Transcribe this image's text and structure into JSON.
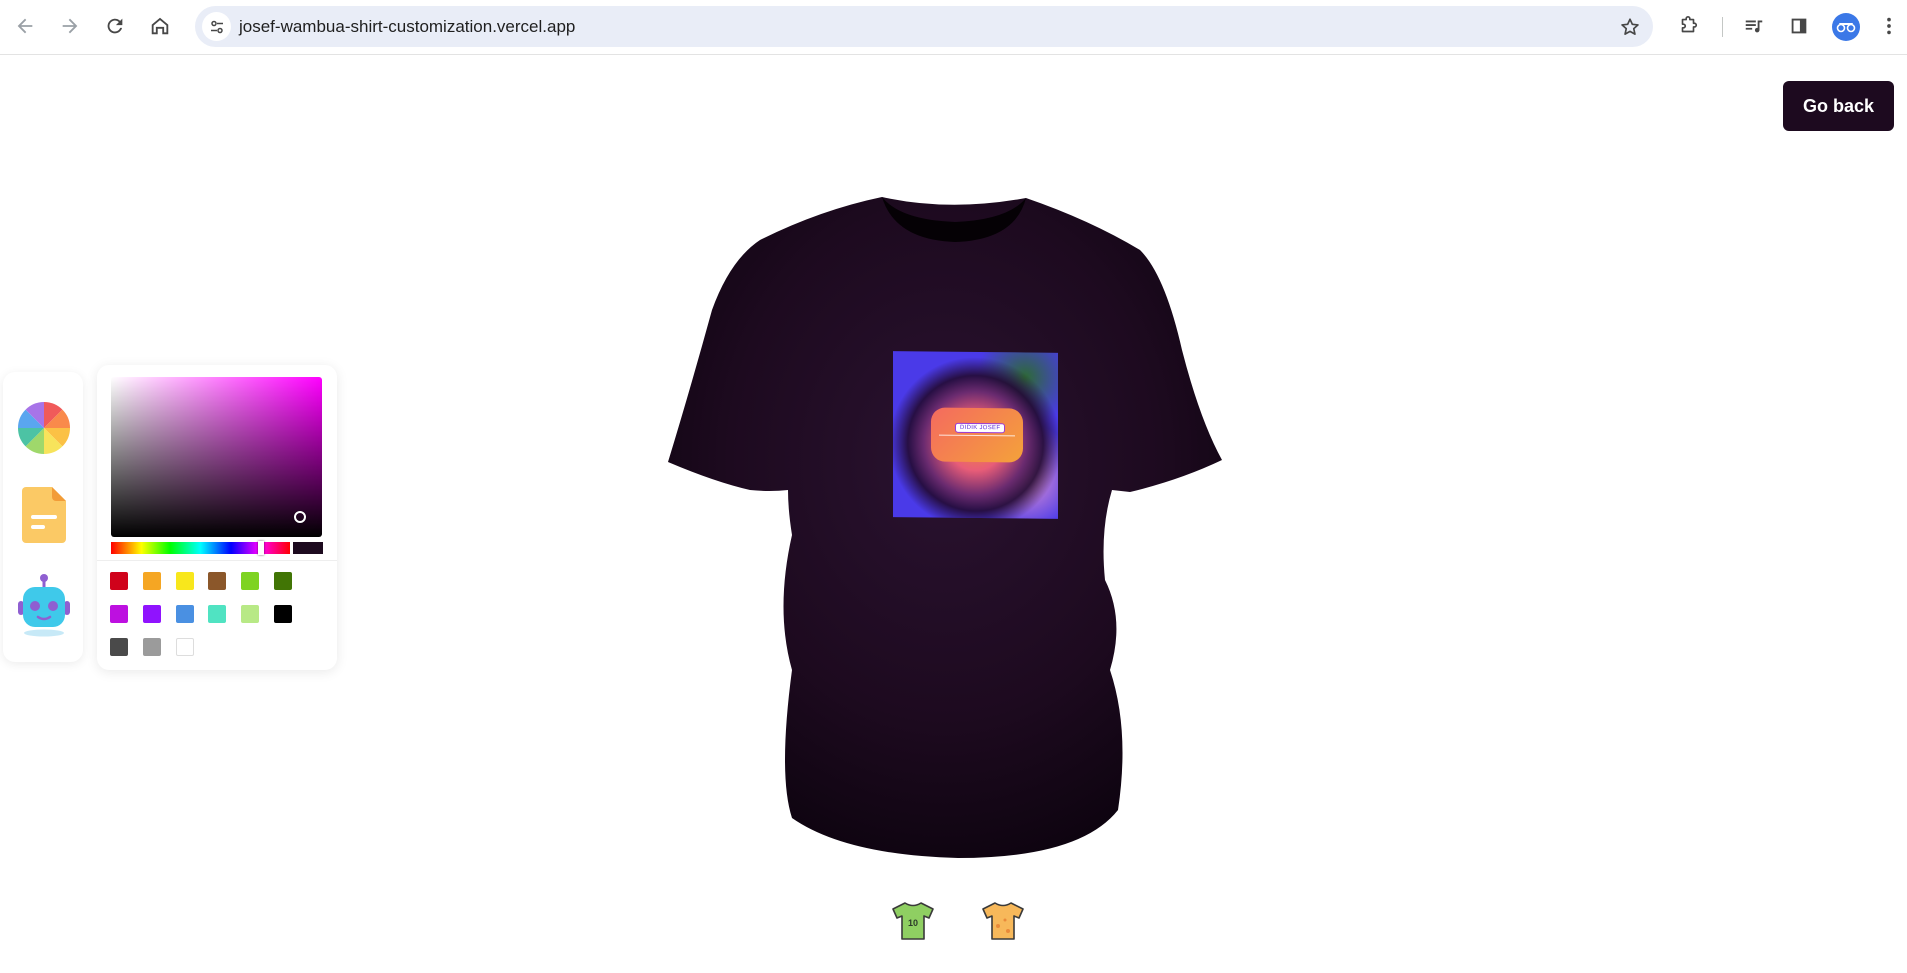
{
  "browser": {
    "url": "josef-wambua-shirt-customization.vercel.app"
  },
  "page": {
    "go_back_label": "Go back",
    "shirt_color": "#1d0a1f",
    "decal_text": "DIDIK JOSEF",
    "filter_tab_logo_text": "10"
  },
  "editor_tabs": [
    {
      "name": "colorpicker",
      "icon": "color-wheel-icon"
    },
    {
      "name": "filepicker",
      "icon": "file-icon"
    },
    {
      "name": "aipicker",
      "icon": "robot-icon"
    }
  ],
  "color_picker": {
    "hue_color": "#ff00ff",
    "selected_color": "#1d0a1f",
    "preset_swatches": [
      "#d0021b",
      "#f5a623",
      "#f8e71c",
      "#8b572a",
      "#7ed321",
      "#417505",
      "#bd10e0",
      "#9013fe",
      "#4a90e2",
      "#50e3c2",
      "#b8e986",
      "#000000",
      "#4a4a4a",
      "#9b9b9b",
      "#ffffff"
    ]
  },
  "filter_tabs": [
    {
      "name": "logo-shirt",
      "icon": "logo-shirt-icon"
    },
    {
      "name": "stylish-shirt",
      "icon": "stylish-shirt-icon"
    }
  ]
}
